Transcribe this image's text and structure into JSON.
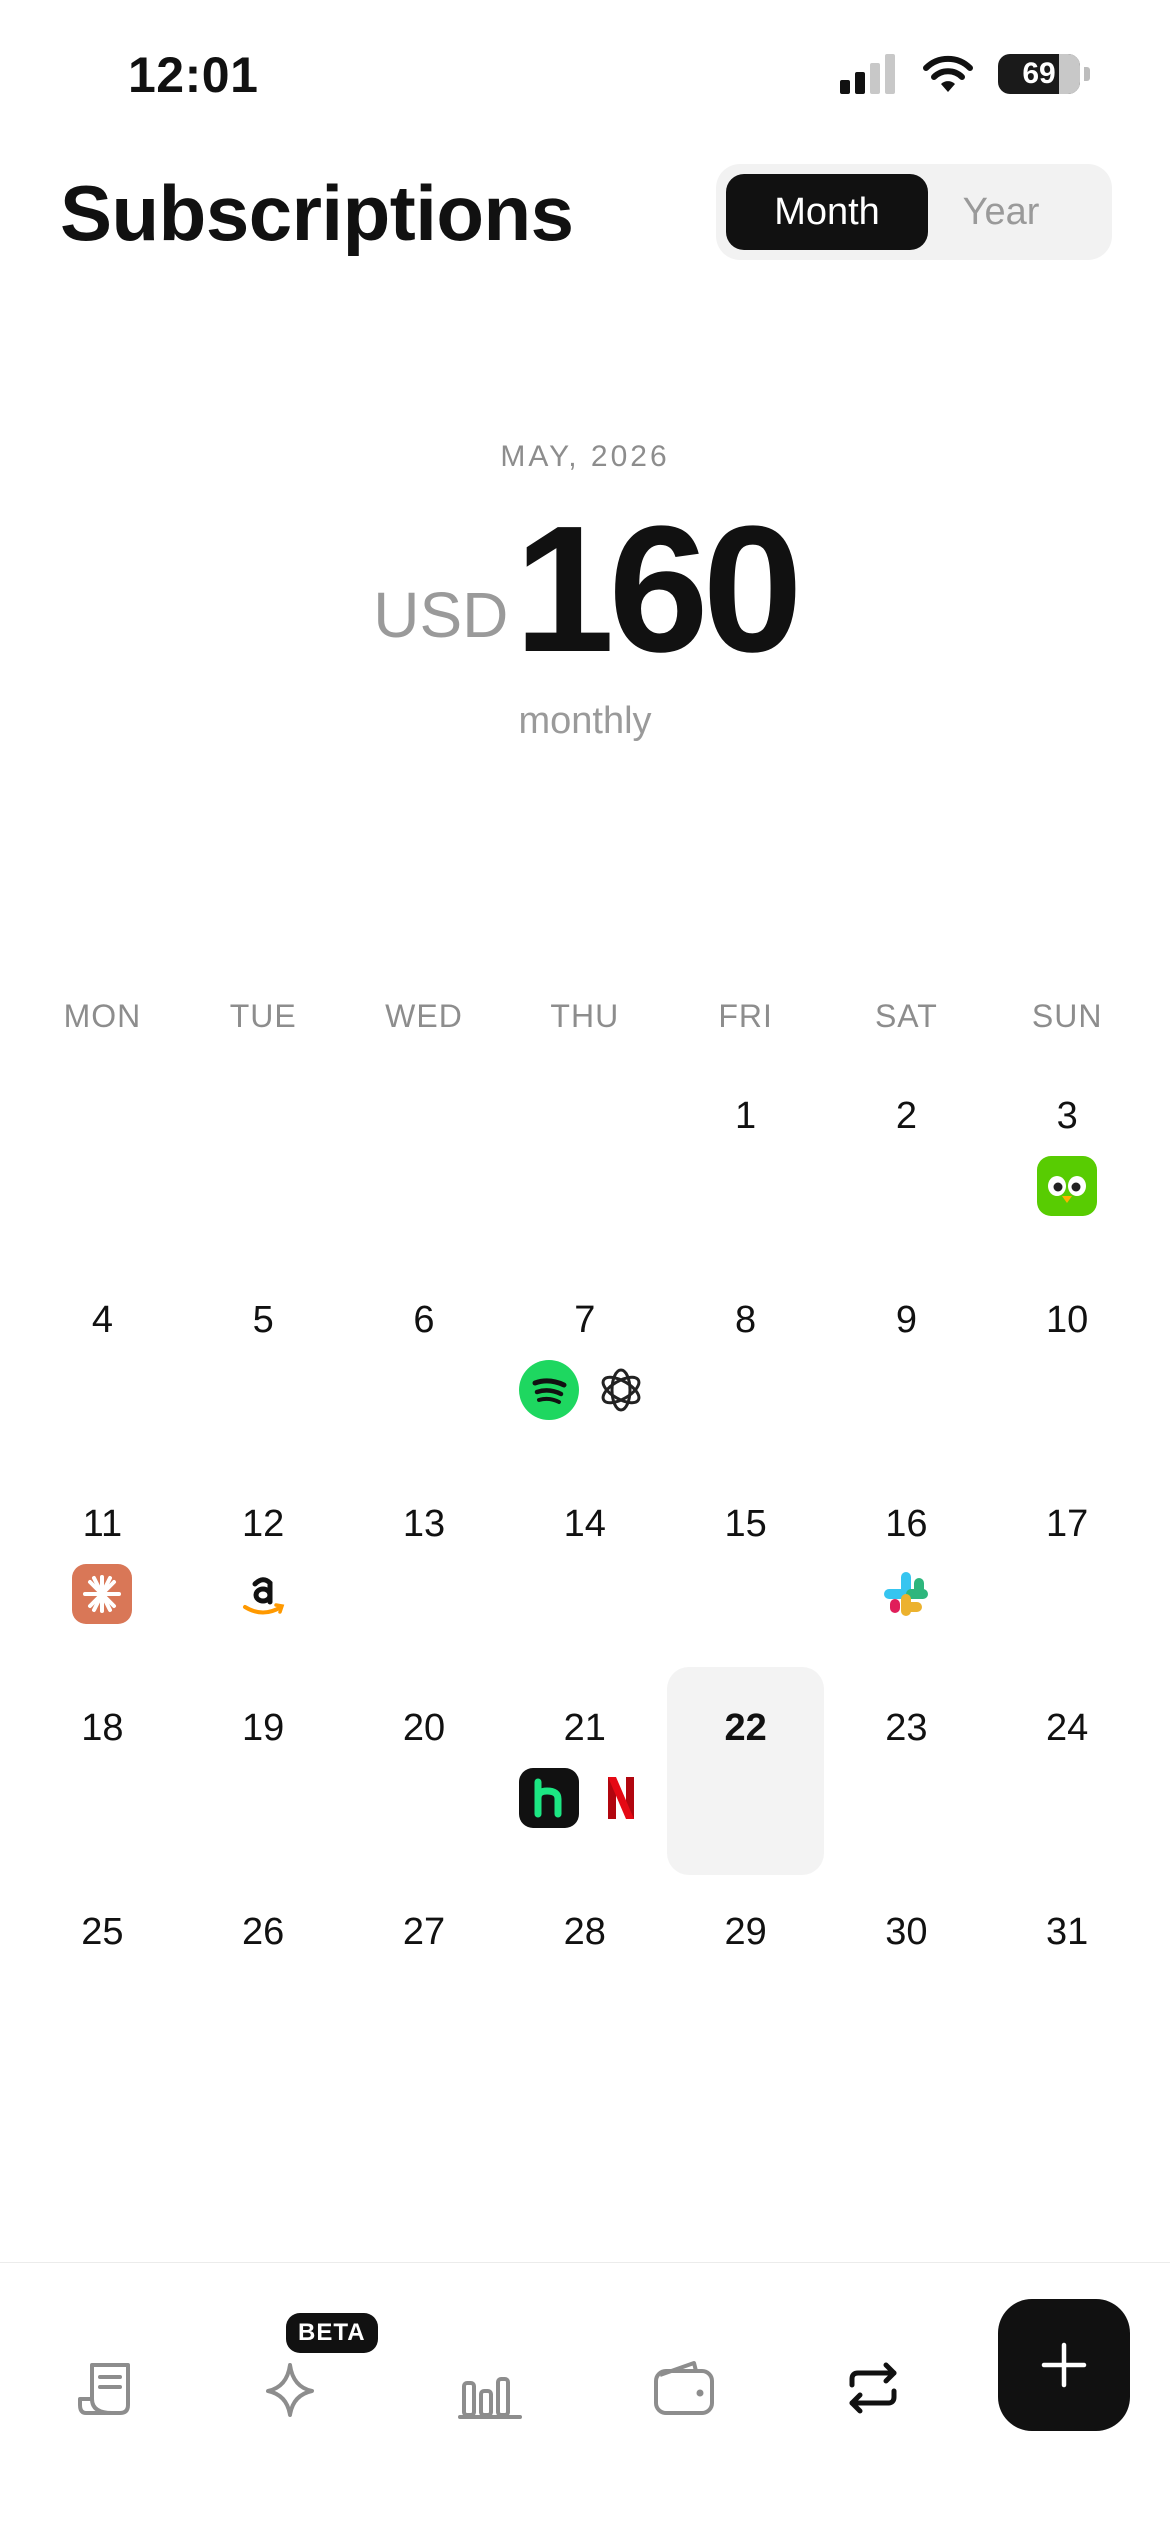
{
  "status_bar": {
    "time": "12:01",
    "battery": "69"
  },
  "header": {
    "title": "Subscriptions",
    "segment": {
      "month": "Month",
      "year": "Year"
    }
  },
  "summary": {
    "period": "MAY, 2026",
    "currency": "USD",
    "amount": "160",
    "frequency": "monthly"
  },
  "calendar": {
    "weekdays": [
      "MON",
      "TUE",
      "WED",
      "THU",
      "FRI",
      "SAT",
      "SUN"
    ],
    "today": "22",
    "days": [
      "1",
      "2",
      "3",
      "4",
      "5",
      "6",
      "7",
      "8",
      "9",
      "10",
      "11",
      "12",
      "13",
      "14",
      "15",
      "16",
      "17",
      "18",
      "19",
      "20",
      "21",
      "22",
      "23",
      "24",
      "25",
      "26",
      "27",
      "28",
      "29",
      "30",
      "31"
    ]
  },
  "subscriptions": {
    "d3": [
      "duolingo-icon"
    ],
    "d7": [
      "spotify-icon",
      "chatgpt-icon"
    ],
    "d11": [
      "claude-icon"
    ],
    "d12": [
      "amazon-icon"
    ],
    "d16": [
      "slack-icon"
    ],
    "d21": [
      "hulu-icon",
      "netflix-icon"
    ]
  },
  "tabbar": {
    "beta_badge": "BETA"
  },
  "colors": {
    "accent": "#111111",
    "muted": "#8d8d8d",
    "today_bg": "#f3f3f3"
  }
}
